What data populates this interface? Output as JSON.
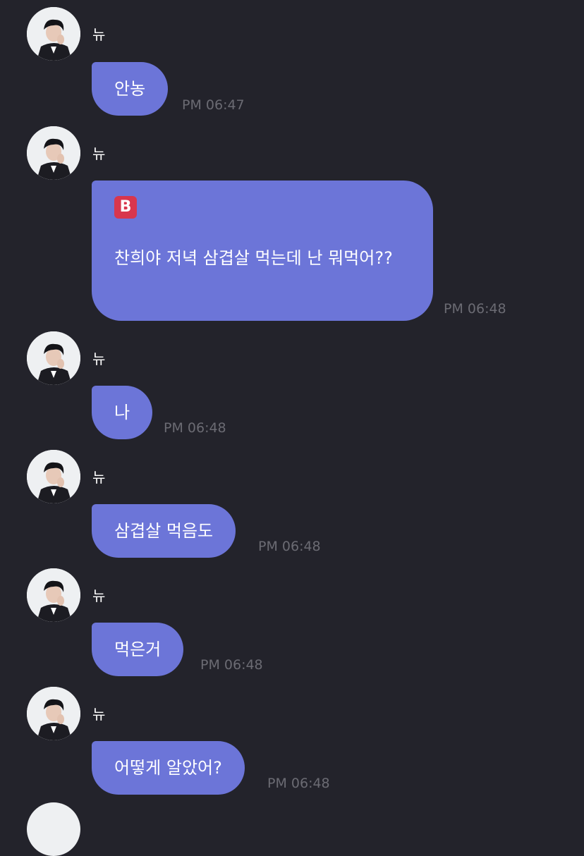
{
  "chat": {
    "messages": [
      {
        "sender": "뉴",
        "text": "안농",
        "time": "PM 06:47"
      },
      {
        "sender": "뉴",
        "emoji": "B",
        "text": "찬희야 저녁 삼겹살 먹는데 난 뭐먹어??",
        "time": "PM 06:48"
      },
      {
        "sender": "뉴",
        "text": "나",
        "time": "PM 06:48"
      },
      {
        "sender": "뉴",
        "text": "삼겹살 먹음도",
        "time": "PM 06:48"
      },
      {
        "sender": "뉴",
        "text": "먹은거",
        "time": "PM 06:48"
      },
      {
        "sender": "뉴",
        "text": "어떻게 알았어?",
        "time": "PM 06:48"
      }
    ]
  },
  "colors": {
    "background": "#23232b",
    "bubble": "#6c75d8",
    "timestamp": "#6b6b73",
    "emoji_badge": "#d8364d"
  },
  "icons": {
    "avatar": "profile-photo",
    "emoji": "b-button-emoji"
  }
}
